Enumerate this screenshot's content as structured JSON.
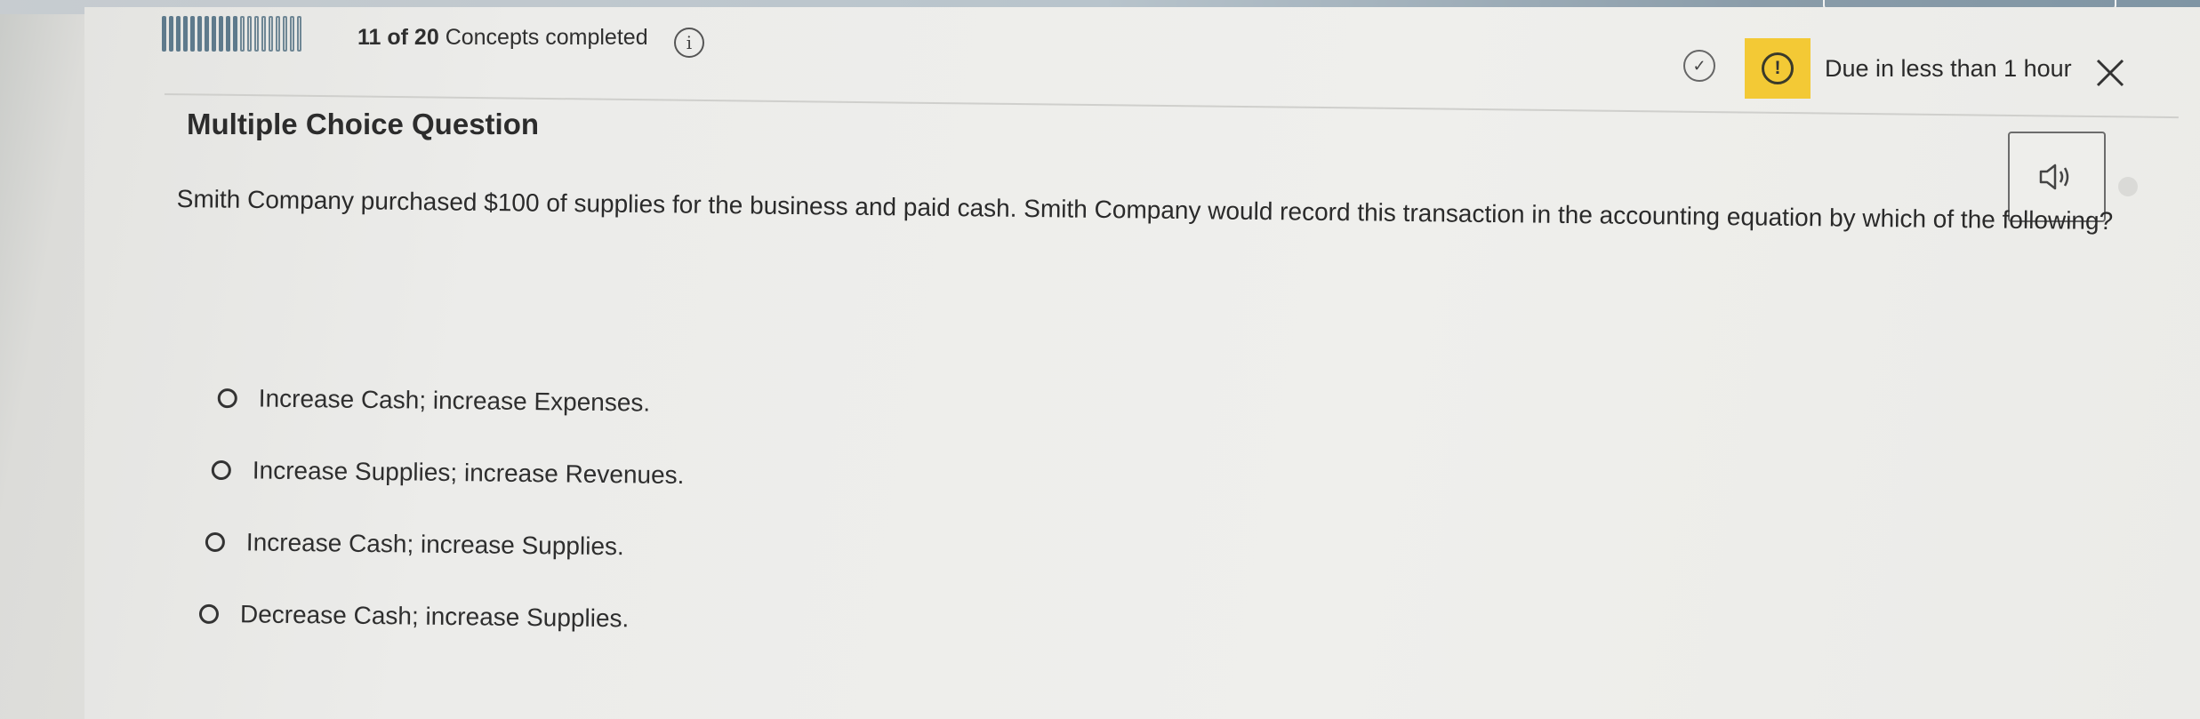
{
  "progress": {
    "completed": 11,
    "total": 20,
    "count_text": "11 of 20",
    "label": "Concepts completed"
  },
  "header": {
    "due_text": "Due in less than 1 hour",
    "colors": {
      "warning": "#f3c935",
      "progress": "#5e7a8c"
    }
  },
  "icons": {
    "info": "info-icon",
    "check": "check-circle-icon",
    "alert": "alert-icon",
    "close": "close-icon",
    "audio": "speaker-icon"
  },
  "question": {
    "type_label": "Multiple Choice Question",
    "text": "Smith Company purchased $100 of supplies for the business and paid cash. Smith Company would record this transaction in the accounting equation by which of the following?",
    "answers": [
      {
        "label": "Increase Cash; increase Expenses."
      },
      {
        "label": "Increase Supplies; increase Revenues."
      },
      {
        "label": "Increase Cash; increase Supplies."
      },
      {
        "label": "Decrease Cash; increase Supplies."
      }
    ]
  }
}
